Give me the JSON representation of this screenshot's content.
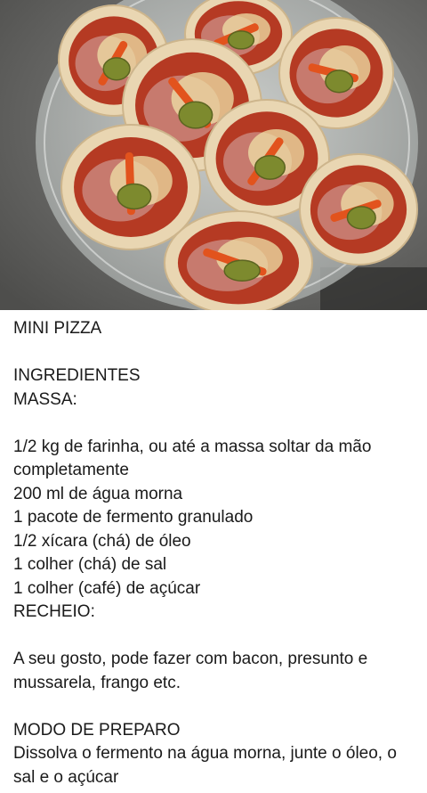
{
  "photo": {
    "subject": "mini-pizzas-photo",
    "colors": {
      "countertop": "#6e6e6c",
      "plate": "#c9ccc9",
      "crust": "#e9d6b2",
      "sauce": "#b53a23",
      "ham": "#c98277",
      "cheese": "#efe2a8",
      "pepper": "#e2531d",
      "olive": "#7d8a2e"
    }
  },
  "recipe": {
    "title": "MINI PIZZA",
    "ingredients_heading": "INGREDIENTES",
    "dough_heading": "MASSA:",
    "dough_items": [
      "1/2 kg de farinha, ou até a massa soltar da mão completamente",
      "200 ml de água morna",
      "1 pacote de fermento granulado",
      "1/2 xícara (chá) de óleo",
      "1 colher (chá) de sal",
      "1 colher (café) de açúcar"
    ],
    "filling_heading": "RECHEIO:",
    "filling_text": "A seu gosto, pode fazer com bacon, presunto e mussarela, frango etc.",
    "method_heading": "MODO DE PREPARO",
    "method_text": "Dissolva o fermento na água morna, junte o óleo, o sal e o açúcar"
  }
}
